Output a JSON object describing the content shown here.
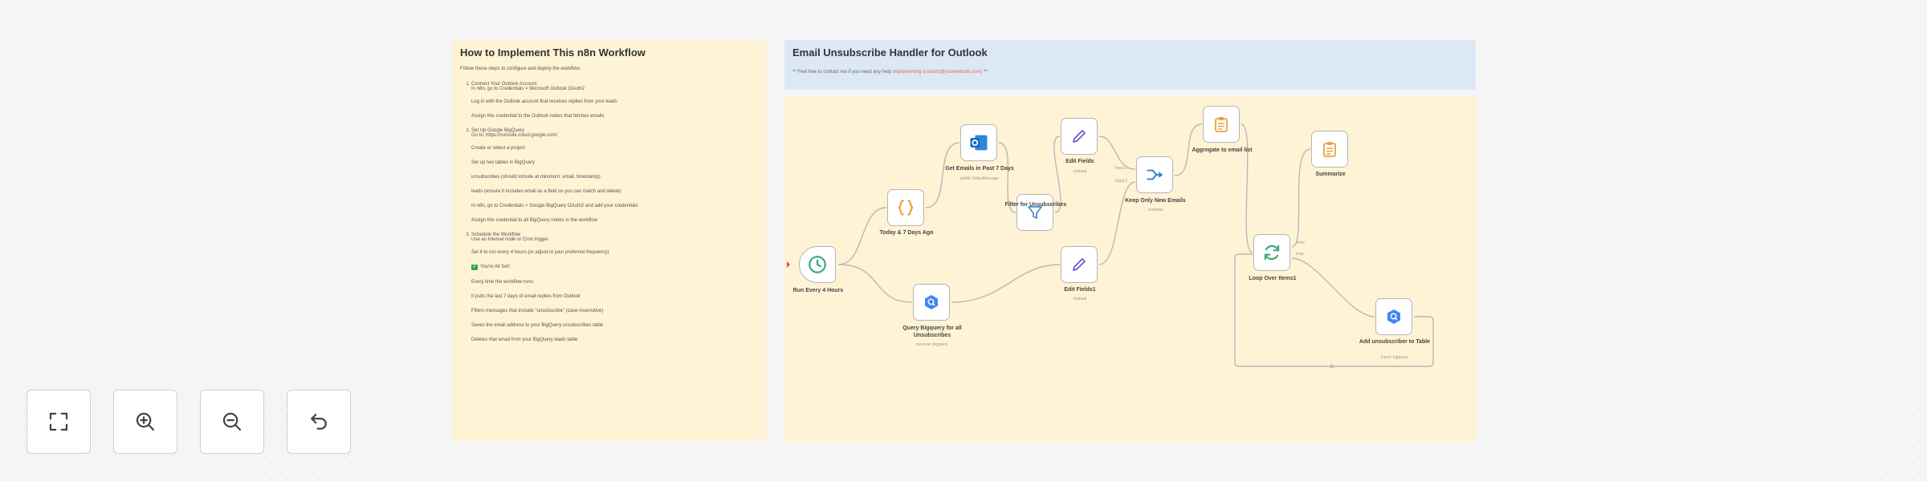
{
  "guide_note": {
    "title": "How to Implement This n8n Workflow",
    "intro": "Follow these steps to configure and deploy the workflow:",
    "steps": [
      {
        "title": "Connect Your Outlook Account",
        "sub": "In n8n, go to Credentials > Microsoft Outlook OAuth2",
        "lines": [
          {
            "text": "Log in with the Outlook account that receives replies from your leads",
            "style": ""
          },
          {
            "text": "Assign this credential to the Outlook nodes that fetches emails",
            "style": ""
          }
        ]
      },
      {
        "title": "Set Up Google BigQuery",
        "sub": "Go to: https://console.cloud.google.com/",
        "lines": [
          {
            "text": "Create or select a project",
            "style": ""
          },
          {
            "text": "Set up two tables in BigQuery",
            "style": ""
          },
          {
            "text": "unsubscribes (should include at minimum: email, timestamp)",
            "style": ""
          },
          {
            "text": "leads (ensure it includes email as a field so you can match and delete)",
            "style": ""
          },
          {
            "text": "In n8n, go to Credentials > Google BigQuery OAuth2 and add your credentials",
            "style": ""
          },
          {
            "text": "Assign this credential to all BigQuery nodes in the workflow",
            "style": ""
          }
        ]
      },
      {
        "title": "Schedule the Workflow",
        "sub": "Use an Interval node or Cron trigger",
        "lines": [
          {
            "text": "Set it to run every 4 hours (or adjust to your preferred frequency)",
            "style": ""
          },
          {
            "text": "You're All Set!",
            "style": "check"
          },
          {
            "text": "Every time the workflow runs:",
            "style": ""
          },
          {
            "text": "It pulls the last 7 days of email replies from Outlook",
            "style": ""
          },
          {
            "text": "Filters messages that include \"unsubscribe\" (case-insensitive)",
            "style": ""
          },
          {
            "text": "Saves the email address to your BigQuery unsubscribes table",
            "style": ""
          },
          {
            "text": "Deletes that email from your BigQuery leads table",
            "style": ""
          }
        ]
      }
    ]
  },
  "title_note": {
    "title": "Email Unsubscribe Handler for Outlook",
    "help_prefix": "** Feel free to contact me if you need any help ",
    "help_email": "implementing (contact@yourwebsite.com)",
    "help_suffix": " **"
  },
  "nodes": [
    {
      "id": "run-every-4-hours",
      "label": "Run Every 4 Hours",
      "sub": "",
      "icon": "clock-icon"
    },
    {
      "id": "today-7-days-ago",
      "label": "Today & 7 Days Ago",
      "sub": "",
      "icon": "code-braces-icon"
    },
    {
      "id": "get-emails",
      "label": "Get Emails in Past 7 Days",
      "sub": "getAll: folderMessage",
      "icon": "outlook-icon"
    },
    {
      "id": "filter-unsubscribes",
      "label": "Filter for Unsubscribes",
      "sub": "",
      "icon": "filter-icon"
    },
    {
      "id": "edit-fields",
      "label": "Edit Fields",
      "sub": "manual",
      "icon": "pencil-icon"
    },
    {
      "id": "edit-fields1",
      "label": "Edit Fields1",
      "sub": "manual",
      "icon": "pencil-icon"
    },
    {
      "id": "query-bigquery",
      "label": "Query Bigquery for all Unsubscribes",
      "sub": "execute: bigquery",
      "icon": "bigquery-icon"
    },
    {
      "id": "keep-only-new",
      "label": "Keep Only New Emails",
      "sub": "combine",
      "icon": "merge-icon"
    },
    {
      "id": "aggregate",
      "label": "Aggregate to email list",
      "sub": "",
      "icon": "clipboard-icon"
    },
    {
      "id": "summarize",
      "label": "Summarize",
      "sub": "",
      "icon": "clipboard-icon"
    },
    {
      "id": "loop-over-items",
      "label": "Loop Over Items1",
      "sub": "",
      "icon": "refresh-icon"
    },
    {
      "id": "add-unsubscriber",
      "label": "Add unsubscriber to Table",
      "sub": "insert: bigquery",
      "icon": "bigquery-icon"
    }
  ],
  "port_labels": {
    "input1": "Input 1",
    "input2": "Input 2",
    "done": "done",
    "loop": "loop"
  },
  "controls": [
    {
      "id": "fit-view",
      "icon": "fullscreen-icon",
      "title": "Fit view"
    },
    {
      "id": "zoom-in",
      "icon": "zoom-in-icon",
      "title": "Zoom in"
    },
    {
      "id": "zoom-out",
      "icon": "zoom-out-icon",
      "title": "Zoom out"
    },
    {
      "id": "reset-zoom",
      "icon": "undo-icon",
      "title": "Reset zoom"
    }
  ],
  "colors": {
    "sticky_yellow": "#fff3d5",
    "sticky_blue": "#dde8f7",
    "accent_red": "#e26a4f",
    "clock": "#3aa87a",
    "code": "#f0a23a",
    "outlook": "#0f6cbd",
    "filter": "#4a90d9",
    "pencil": "#6e5bd1",
    "bigquery": "#4285f4",
    "merge": "#3d7fd1",
    "clipboard": "#f0a23a",
    "loop": "#3aa87a"
  }
}
